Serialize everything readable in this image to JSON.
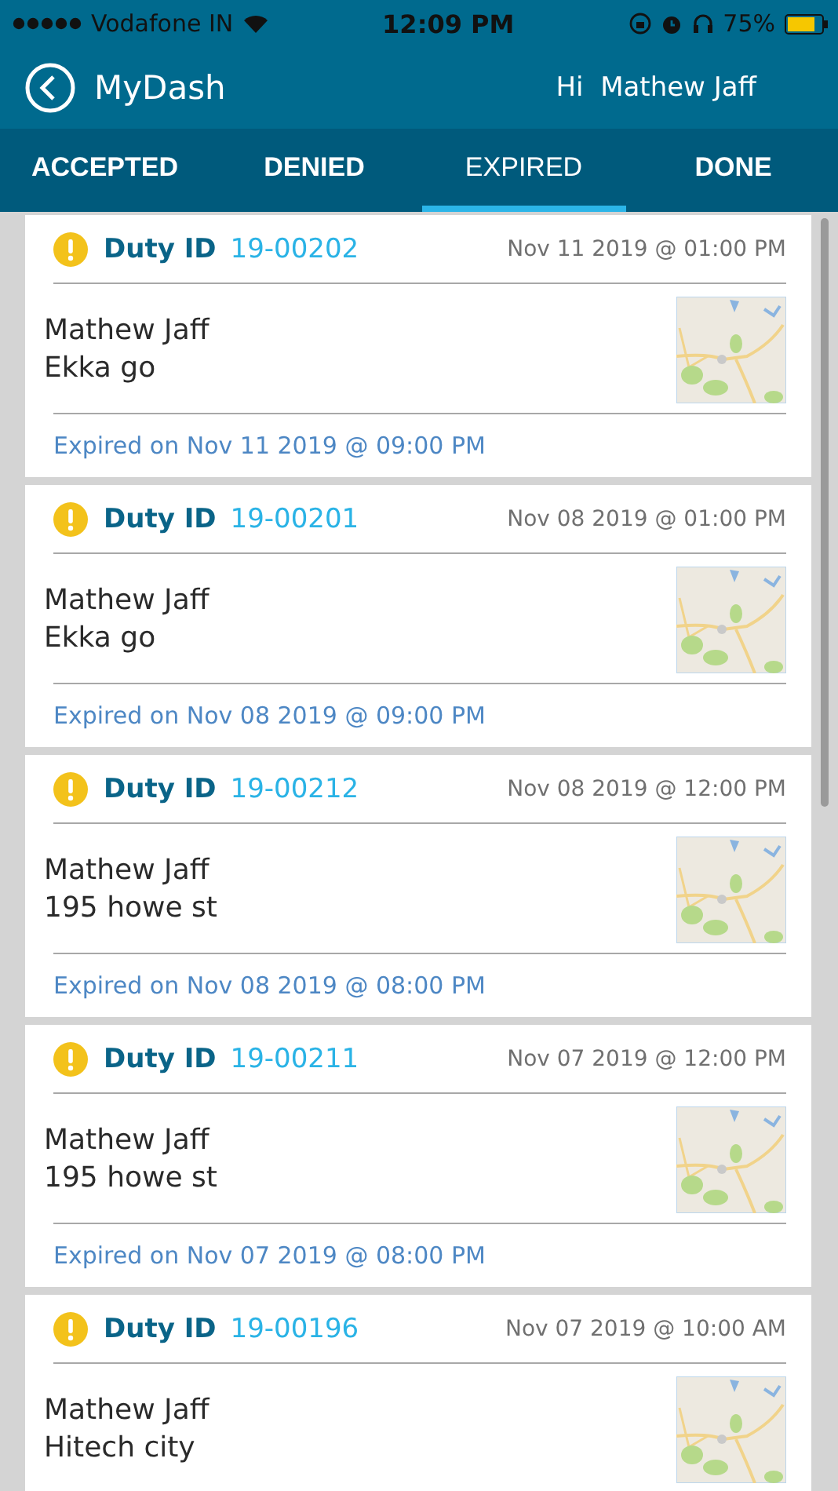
{
  "status_bar": {
    "carrier": "Vodafone IN",
    "time": "12:09 PM",
    "battery": "75%"
  },
  "header": {
    "title": "MyDash",
    "greeting": "Hi  Mathew Jaff"
  },
  "tabs": [
    {
      "label": "ACCEPTED",
      "selected": false
    },
    {
      "label": "DENIED",
      "selected": false
    },
    {
      "label": "EXPIRED",
      "selected": true
    },
    {
      "label": "DONE",
      "selected": false
    }
  ],
  "duties": [
    {
      "id_label": "Duty ID",
      "id": "19-00202",
      "scheduled": "Nov 11 2019 @ 01:00 PM",
      "name": "Mathew Jaff",
      "place": "Ekka go",
      "expired": "Expired on Nov 11 2019 @ 09:00 PM"
    },
    {
      "id_label": "Duty ID",
      "id": "19-00201",
      "scheduled": "Nov 08 2019 @ 01:00 PM",
      "name": "Mathew Jaff",
      "place": "Ekka go",
      "expired": "Expired on Nov 08 2019 @ 09:00 PM"
    },
    {
      "id_label": "Duty ID",
      "id": "19-00212",
      "scheduled": "Nov 08 2019 @ 12:00 PM",
      "name": "Mathew Jaff",
      "place": "195 howe st",
      "expired": "Expired on Nov 08 2019 @ 08:00 PM"
    },
    {
      "id_label": "Duty ID",
      "id": "19-00211",
      "scheduled": "Nov 07 2019 @ 12:00 PM",
      "name": "Mathew Jaff",
      "place": "195 howe st",
      "expired": "Expired on Nov 07 2019 @ 08:00 PM"
    },
    {
      "id_label": "Duty ID",
      "id": "19-00196",
      "scheduled": "Nov 07 2019 @ 10:00 AM",
      "name": "Mathew Jaff",
      "place": "Hitech city"
    }
  ]
}
